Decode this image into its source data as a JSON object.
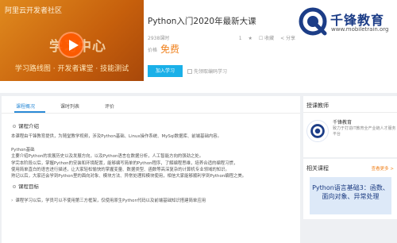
{
  "banner": {
    "site_text": "阿里云开发者社区",
    "center_text": "学习中心",
    "tags": "学习路线图 · 开发者课堂 · 技能测试"
  },
  "course": {
    "title": "Python入门2020年最新大课",
    "learners": "2938课时",
    "meta_items": [
      "1",
      "★",
      "☐ 收藏",
      "< 分享"
    ],
    "price_label": "价格",
    "price": "免费",
    "join_label": "加入学习",
    "fav_label": "先领取编码学习"
  },
  "logo": {
    "name": "千锋教育",
    "url": "www.mobiletrain.org",
    "color": "#1c3d87"
  },
  "tabs": [
    {
      "label": "课程概况",
      "active": true
    },
    {
      "label": "课时列表",
      "active": false
    },
    {
      "label": "评价",
      "active": false
    }
  ],
  "intro": {
    "title": "课程介绍",
    "lines": [
      "本课程由千锋教育提供，为随堂教学视频，涉及Python基础、Linux操作系统、MySql数据库、前端基础内容。",
      "",
      "Python基础",
      "主要介绍Python的发展历史以及发展方向，以及Python语言在数据分析，人工智能方向的强劲之处。",
      "学完本阶段以后，掌握Python的安装和环境配置，能够编写简单的Python程序，了解编程思维，培养合适的编程习惯，",
      "使用简单直白的语言进行描述，让大家轻松愉快的掌握变量、数据类型、函数等高深复杂的计算机专业领域的知识。",
      "熟记以后，大家还会学到Python里的面向对象、模块方法、异常处理和模块使用，相信大家能够顺利学到Python编程之美。"
    ]
  },
  "target": {
    "title": "课程目标",
    "item": "课程学习以后，学员可以不使用第三方框架，仅使用原生Python代码以及前端基础知识搭建简单应用"
  },
  "instructor": {
    "header": "授课教师",
    "name": "千锋教育",
    "desc": "致力于打造IT教育全产业链人才服务平台"
  },
  "related": {
    "header": "相关课程",
    "more": "查看更多 >",
    "course_title": "Python语言基础3：函数、面向对象、异常处理"
  },
  "colors": {
    "accent": "#2b8ad6",
    "join_button": "#1ab0e8",
    "price": "#f0821e"
  }
}
